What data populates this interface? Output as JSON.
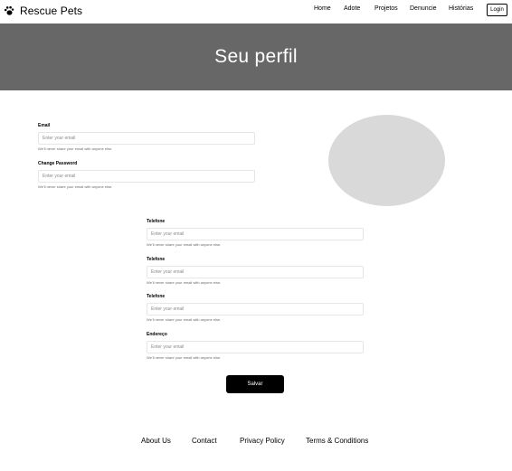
{
  "brand": {
    "name": "Rescue Pets",
    "icon": "paw-icon"
  },
  "nav": {
    "links": [
      "Home",
      "Adote",
      "Projetos",
      "Denuncie",
      "Histórias"
    ],
    "login_label": "Login"
  },
  "hero": {
    "title": "Seu perfil"
  },
  "account_form": {
    "email": {
      "label": "Email",
      "placeholder": "Enter your email",
      "help": "We'll never share your email with anyone else."
    },
    "password": {
      "label": "Change Password",
      "placeholder": "Enter your email",
      "help": "We'll never share your email with anyone else."
    }
  },
  "details_form": {
    "fields": [
      {
        "label": "Telefone",
        "placeholder": "Enter your email",
        "help": "We'll never share your email with anyone else."
      },
      {
        "label": "Telefone",
        "placeholder": "Enter your email",
        "help": "We'll never share your email with anyone else."
      },
      {
        "label": "Telefone",
        "placeholder": "Enter your email",
        "help": "We'll never share your email with anyone else."
      },
      {
        "label": "Endereço",
        "placeholder": "Enter your email",
        "help": "We'll never share your email with anyone else."
      }
    ],
    "save_label": "Salvar"
  },
  "footer": {
    "links": [
      "About Us",
      "Contact",
      "Privacy Policy",
      "Terms & Conditions"
    ]
  },
  "colors": {
    "hero_bg": "#676767",
    "avatar_bg": "#d9d9d9",
    "button_bg": "#000000",
    "input_border": "#e6e6e6"
  }
}
